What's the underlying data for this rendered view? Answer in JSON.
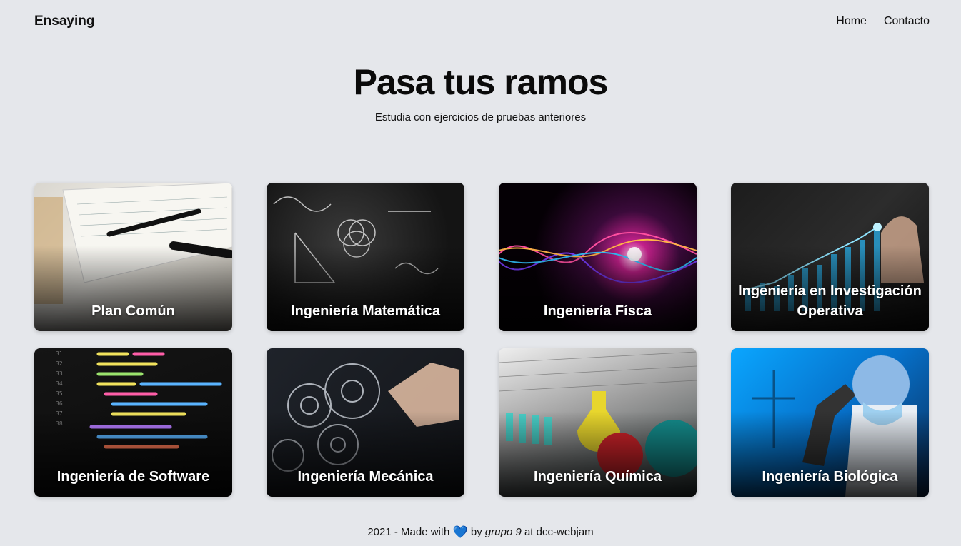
{
  "nav": {
    "brand": "Ensaying",
    "links": [
      "Home",
      "Contacto"
    ]
  },
  "hero": {
    "title": "Pasa tus ramos",
    "subtitle": "Estudia con ejercicios de pruebas anteriores"
  },
  "cards": [
    {
      "label": "Plan Común"
    },
    {
      "label": "Ingeniería Matemática"
    },
    {
      "label": "Ingeniería Físca"
    },
    {
      "label": "Ingeniería en Investigación Operativa"
    },
    {
      "label": "Ingeniería de Software"
    },
    {
      "label": "Ingeniería Mecánica"
    },
    {
      "label": "Ingeniería Química"
    },
    {
      "label": "Ingeniería Biológica"
    }
  ],
  "footer": {
    "prefix": "2021 - Made with",
    "heart": "💙",
    "by": "by",
    "group": "grupo 9",
    "suffix": "at dcc-webjam"
  },
  "colors": {
    "background": "#e5e7eb",
    "heart": "#1d6fd6"
  }
}
